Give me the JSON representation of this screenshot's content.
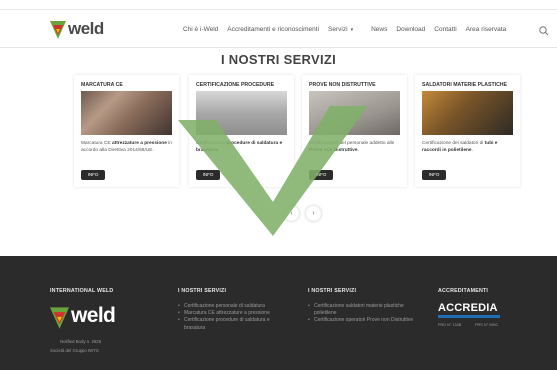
{
  "header": {
    "logo_text": "weld",
    "nav": [
      {
        "label": "Chi è i-Weld"
      },
      {
        "label": "Accreditamenti e riconoscimenti"
      },
      {
        "label": "Servizi"
      },
      {
        "label": "News"
      },
      {
        "label": "Download"
      },
      {
        "label": "Contatti"
      },
      {
        "label": "Area riservata"
      }
    ],
    "search_icon": "search-icon"
  },
  "main": {
    "title": "I NOSTRI SERVIZI",
    "cards": [
      {
        "title": "MARCATURA CE",
        "text_before": "Marcatura CE ",
        "text_bold": "attrezzature a pressione",
        "text_after": " in accordo alla Direttiva 2014/68/UE.",
        "button": "INFO"
      },
      {
        "title": "CERTIFICAZIONE PROCEDURE",
        "text_before": "Certificazione ",
        "text_bold": "procedure di saldatura e brasatura",
        "text_after": ".",
        "button": "INFO"
      },
      {
        "title": "PROVE NON DISTRUTTIVE",
        "text_before": "Certificazione del personale addetto alle ",
        "text_bold": "Prove non Distruttive",
        "text_after": ".",
        "button": "INFO"
      },
      {
        "title": "SALDATORI MATERIE PLASTICHE",
        "text_before": "Certificazione dei saldatori di ",
        "text_bold": "tubi e raccordi in polietilene",
        "text_after": ".",
        "button": "INFO"
      }
    ],
    "slider_prev": "‹",
    "slider_next": "›",
    "overlay_color": "#7fb069"
  },
  "footer": {
    "col1": {
      "heading": "INTERNATIONAL WELD",
      "logo_text": "weld",
      "line1": "Notified Body n. 2526",
      "line2": "Società del Gruppo IWTS"
    },
    "col2": {
      "heading": "I NOSTRI SERVIZI",
      "items": [
        "Certificazione personale di saldatura",
        "Marcatura CE attrezzature a pressione",
        "Certificazione procedure di saldatura e brasatura"
      ]
    },
    "col3": {
      "heading": "I NOSTRI SERVIZI",
      "items": [
        "Certificazione saldatori materie plastiche polietilene",
        "Certificazione operatori Prove non Distruttive"
      ]
    },
    "col4": {
      "heading": "ACCREDITAMENTI",
      "logo_text": "ACCREDIA",
      "sub1": "PRD N° 134B",
      "sub2": "PRS N° 095C"
    }
  },
  "colors": {
    "footer_bg": "#2b2b2b",
    "button_bg": "#2b2b2b",
    "brand_green": "#6aa33c",
    "brand_red": "#d0312d",
    "brand_yellow": "#f2c200"
  }
}
